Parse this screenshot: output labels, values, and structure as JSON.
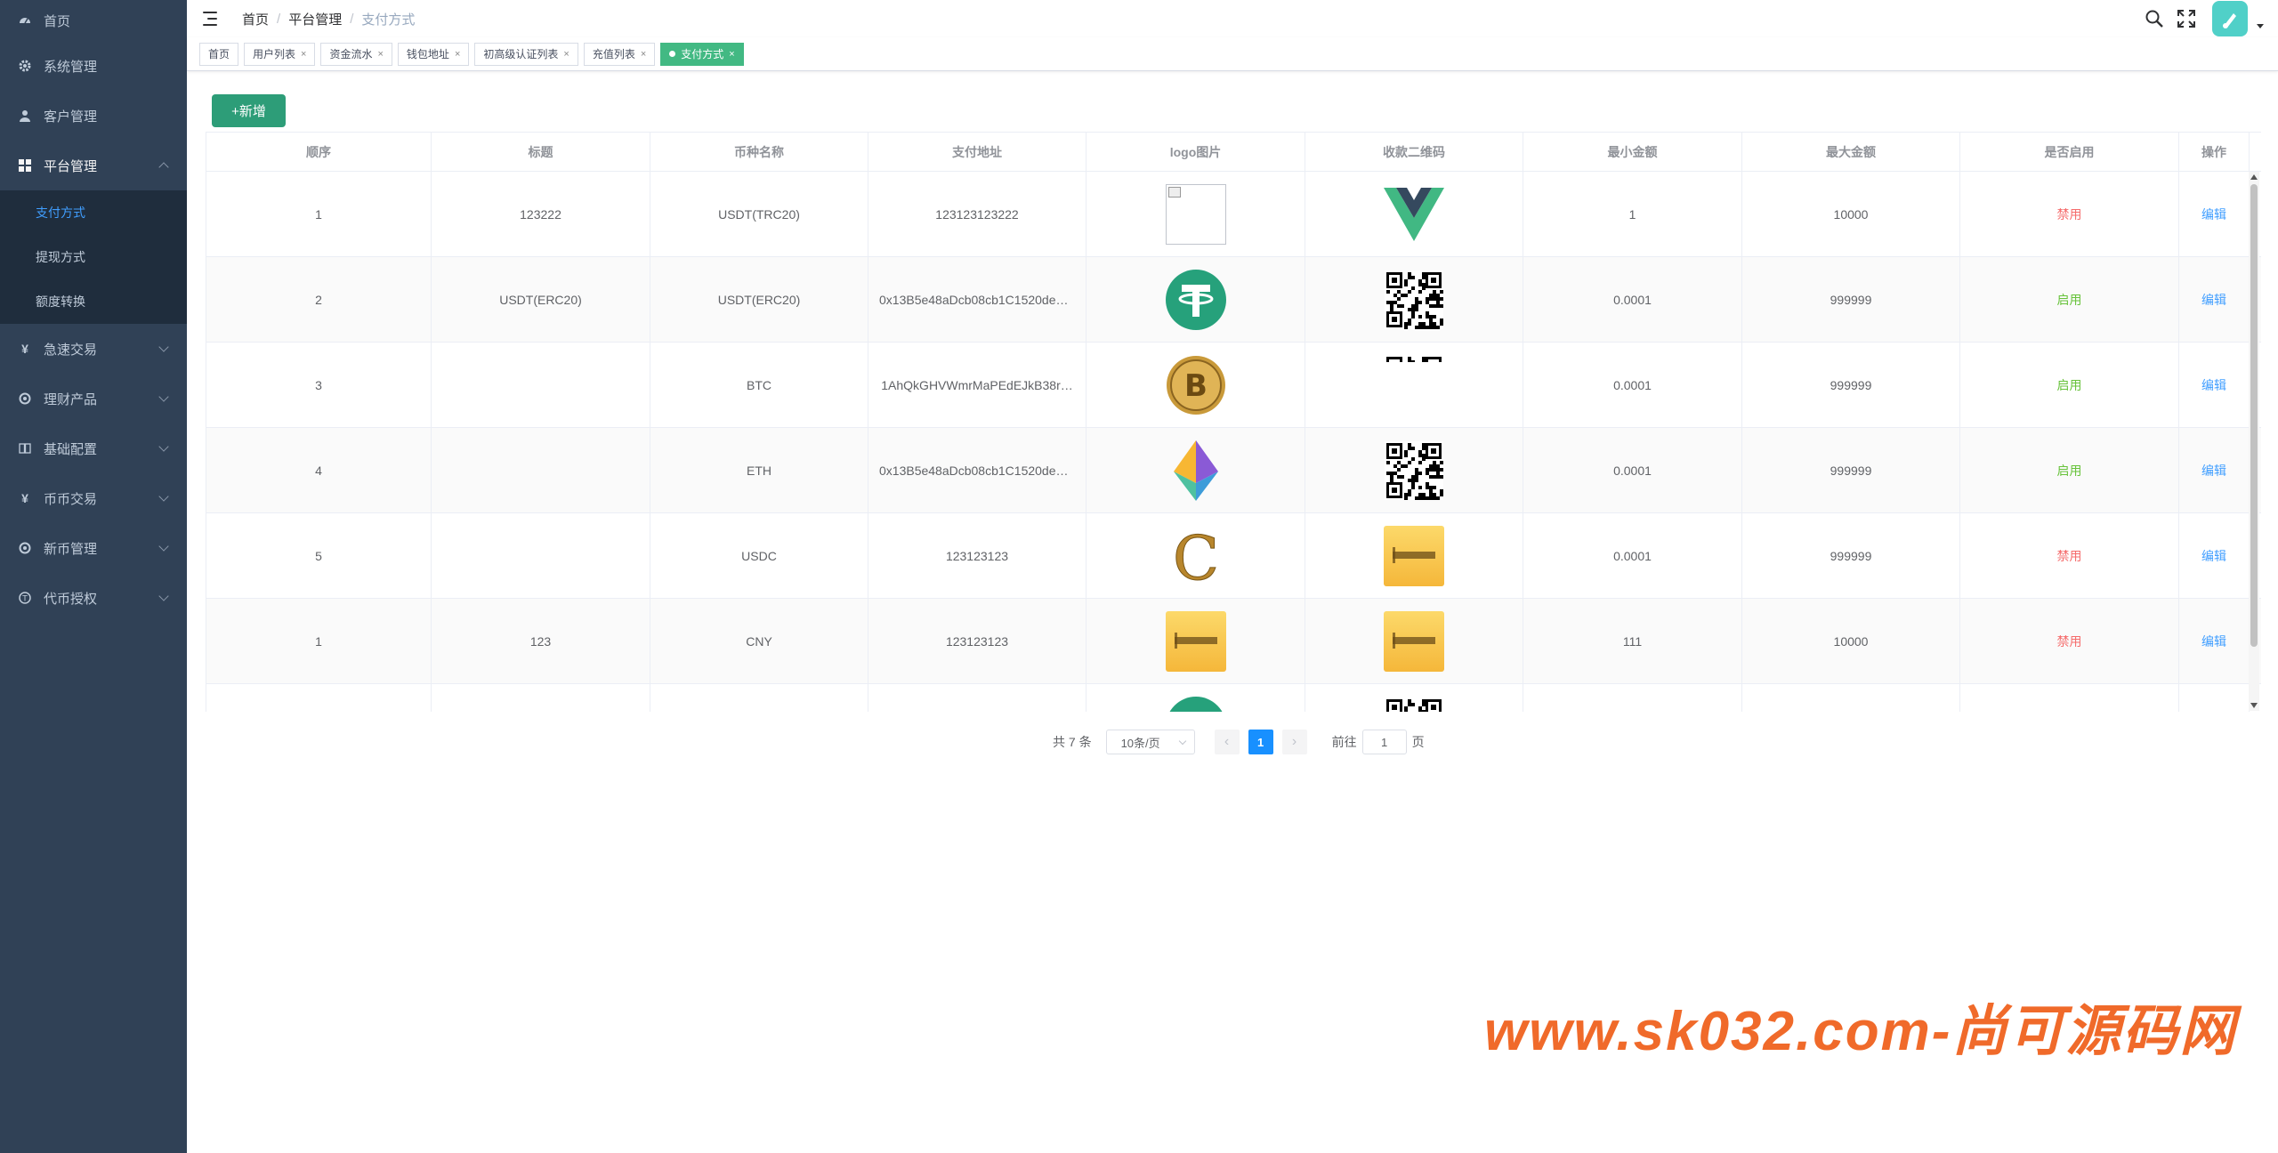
{
  "sidebar": {
    "items": [
      {
        "label": "首页",
        "icon": "dashboard-icon"
      },
      {
        "label": "系统管理",
        "icon": "gear-icon"
      },
      {
        "label": "客户管理",
        "icon": "user-icon"
      },
      {
        "label": "平台管理",
        "icon": "grid-icon"
      },
      {
        "label": "急速交易",
        "icon": "yen-icon"
      },
      {
        "label": "理财产品",
        "icon": "target-icon"
      },
      {
        "label": "基础配置",
        "icon": "book-icon"
      },
      {
        "label": "币币交易",
        "icon": "yen-icon"
      },
      {
        "label": "新币管理",
        "icon": "target-icon"
      },
      {
        "label": "代币授权",
        "icon": "coin-icon"
      }
    ],
    "submenu": [
      {
        "label": "支付方式",
        "active": true
      },
      {
        "label": "提现方式",
        "active": false
      },
      {
        "label": "额度转换",
        "active": false
      }
    ]
  },
  "header": {
    "breadcrumb": [
      "首页",
      "平台管理",
      "支付方式"
    ]
  },
  "tags": [
    "首页",
    "用户列表",
    "资金流水",
    "钱包地址",
    "初高级认证列表",
    "充值列表",
    "支付方式"
  ],
  "toolbar": {
    "add_label": "+新增"
  },
  "table": {
    "columns": [
      "顺序",
      "标题",
      "币种名称",
      "支付地址",
      "logo图片",
      "收款二维码",
      "最小金额",
      "最大金额",
      "是否启用",
      "操作"
    ],
    "rows": [
      {
        "order": "1",
        "title": "123222",
        "coin": "USDT(TRC20)",
        "address": "123123123222",
        "logo": "broken-image",
        "qr": "vue-logo",
        "min": "1",
        "max": "10000",
        "status": "禁用",
        "action": "编辑"
      },
      {
        "order": "2",
        "title": "USDT(ERC20)",
        "coin": "USDT(ERC20)",
        "address": "0x13B5e48aDcb08cb1C1520deB…",
        "logo": "tether-logo",
        "qr": "qr-code",
        "min": "0.0001",
        "max": "999999",
        "status": "启用",
        "action": "编辑"
      },
      {
        "order": "3",
        "title": "",
        "coin": "BTC",
        "address": "1AhQkGHVWmrMaPEdEJkB38r…",
        "logo": "bitcoin-logo",
        "qr": "qr-code-cut",
        "min": "0.0001",
        "max": "999999",
        "status": "启用",
        "action": "编辑"
      },
      {
        "order": "4",
        "title": "",
        "coin": "ETH",
        "address": "0x13B5e48aDcb08cb1C1520deB…",
        "logo": "ethereum-logo",
        "qr": "qr-code",
        "min": "0.0001",
        "max": "999999",
        "status": "启用",
        "action": "编辑"
      },
      {
        "order": "5",
        "title": "",
        "coin": "USDC",
        "address": "123123123",
        "logo": "usdc-gold-logo",
        "qr": "yellow-banner",
        "min": "0.0001",
        "max": "999999",
        "status": "禁用",
        "action": "编辑"
      },
      {
        "order": "1",
        "title": "123",
        "coin": "CNY",
        "address": "123123123",
        "logo": "yellow-banner",
        "qr": "yellow-banner",
        "min": "111",
        "max": "10000",
        "status": "禁用",
        "action": "编辑"
      },
      {
        "order": "",
        "title": "",
        "coin": "",
        "address": "",
        "logo": "tether-logo",
        "qr": "qr-code",
        "min": "",
        "max": "",
        "status": "",
        "action": ""
      }
    ]
  },
  "pagination": {
    "total_text": "共 7 条",
    "page_size": "10条/页",
    "current_page": "1",
    "goto_label": "前往",
    "goto_value": "1",
    "page_suffix": "页"
  },
  "watermark": "www.sk032.com-尚可源码网",
  "colors": {
    "sidebar_bg": "#304156",
    "active_blue": "#409eff",
    "tag_active": "#42b983",
    "add_button": "#2d9d78",
    "disabled_red": "#f56c6c",
    "enabled_green": "#67c23a",
    "watermark": "#f06a2a"
  }
}
